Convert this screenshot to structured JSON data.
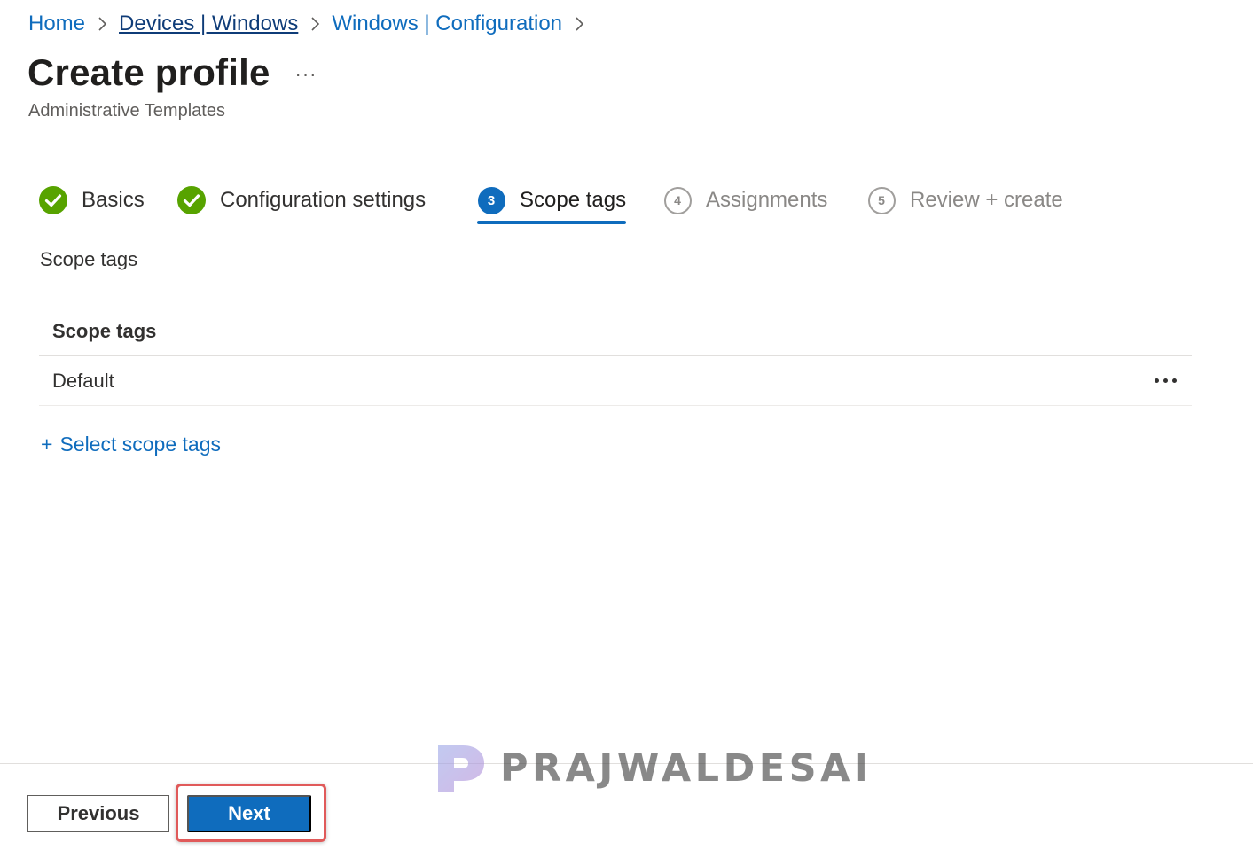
{
  "breadcrumb": {
    "items": [
      "Home",
      "Devices | Windows",
      "Windows | Configuration"
    ]
  },
  "page": {
    "title": "Create profile",
    "more_label": "···",
    "subtitle": "Administrative Templates"
  },
  "wizard": {
    "steps": [
      {
        "label": "Basics",
        "status": "completed"
      },
      {
        "label": "Configuration settings",
        "status": "completed"
      },
      {
        "number": "3",
        "label": "Scope tags",
        "status": "active"
      },
      {
        "number": "4",
        "label": "Assignments",
        "status": "pending"
      },
      {
        "number": "5",
        "label": "Review + create",
        "status": "pending"
      }
    ]
  },
  "section": {
    "label": "Scope tags"
  },
  "table": {
    "header": "Scope tags",
    "rows": [
      {
        "value": "Default"
      }
    ]
  },
  "add_link": {
    "plus": "+",
    "label": "Select scope tags"
  },
  "footer": {
    "previous_label": "Previous",
    "next_label": "Next"
  },
  "watermark": {
    "text": "PRAJWALDESAI"
  },
  "colors": {
    "accent": "#0f6cbd",
    "success": "#57a300",
    "highlight": "#e05a5a"
  },
  "icons": {
    "chevron": "chevron-right-icon",
    "completed": "checkmark-circle-icon",
    "more": "more-horizontal-icon"
  }
}
